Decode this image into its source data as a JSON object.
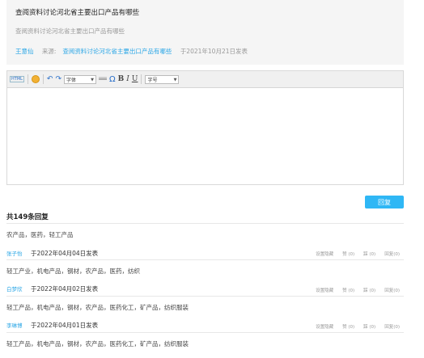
{
  "post": {
    "title": "查阅资料讨论河北省主要出口产品有哪些",
    "description": "查阅资料讨论河北省主要出口产品有哪些",
    "author": "王意仙",
    "source_label": "来源:",
    "source_link": "查阅资料讨论河北省主要出口产品有哪些",
    "published": "于2021年10月21日发表"
  },
  "editor": {
    "toolbar": {
      "html_label": "HTML",
      "font_label": "字体",
      "size_label": "字号",
      "bold": "B",
      "italic": "I",
      "underline": "U",
      "omega": "Ω",
      "undo": "↶",
      "redo": "↷"
    }
  },
  "reply_button": "回复",
  "reply_count": "共149条回复",
  "replies": [
    {
      "content": "农产品，医药，轻工产品",
      "author": "张子怡",
      "date": "于2022年04月04日发表",
      "actions": [
        "设置隐藏",
        "赞 (0)",
        "踩 (0)",
        "回复(0)"
      ]
    },
    {
      "content": "轻工产业，机电产品，钢材，农产品，医药，纺织",
      "author": "白梦欣",
      "date": "于2022年04月02日发表",
      "actions": [
        "设置隐藏",
        "赞 (0)",
        "踩 (0)",
        "回复(0)"
      ]
    },
    {
      "content": "轻工产品，机电产品，钢材，农产品，医药化工，矿产品，纺织服装",
      "author": "李琳博",
      "date": "于2022年04月01日发表",
      "actions": [
        "设置隐藏",
        "赞 (0)",
        "踩 (0)",
        "回复(0)"
      ]
    },
    {
      "content": "轻工产品，机电产品，钢材，农产品，医药化工，矿产品，纺织服装"
    }
  ],
  "colors": {
    "accent": "#2fb7f5",
    "link": "#2aa6e6",
    "post_bg": "#f5f5f5"
  }
}
